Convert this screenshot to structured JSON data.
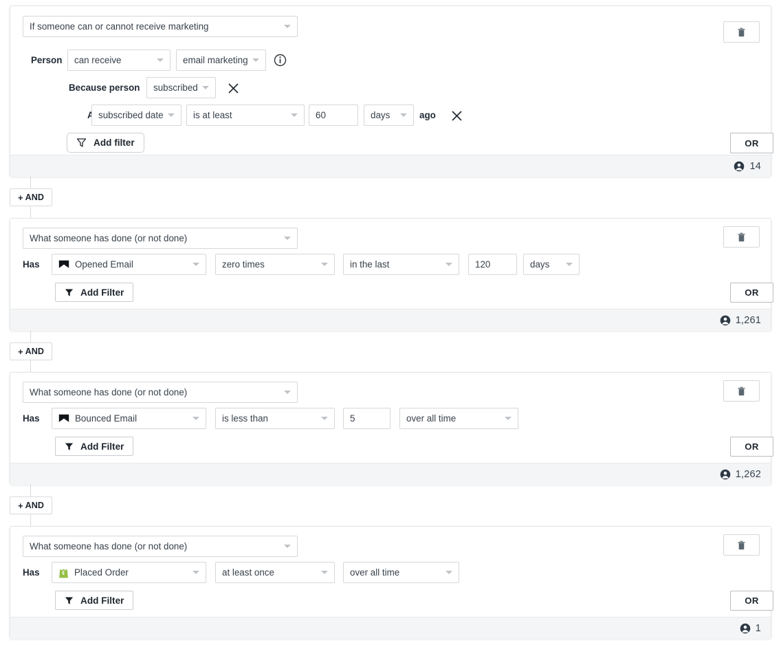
{
  "blocks": [
    {
      "id": "block-marketing",
      "type_select": "If someone can or cannot receive marketing",
      "rows": {
        "person_label": "Person",
        "can_receive": "can receive",
        "channel": "email marketing",
        "info_icon": "info-icon",
        "because_label": "Because person",
        "because_value": "subscribed",
        "and_label": "And",
        "date_field": "subscribed date",
        "operator": "is at least",
        "number": "60",
        "unit": "days",
        "ago_label": "ago"
      },
      "add_filter_label": "Add filter",
      "or_label": "OR",
      "delete_icon": "trash-icon",
      "count": "14"
    },
    {
      "id": "block-opened-email",
      "type_select": "What someone has done (or not done)",
      "rows": {
        "has_label": "Has",
        "metric": "Opened Email",
        "metric_icon": "klaviyo-email-icon",
        "frequency": "zero times",
        "timeframe": "in the last",
        "number": "120",
        "unit": "days"
      },
      "add_filter_label": "Add Filter",
      "or_label": "OR",
      "delete_icon": "trash-icon",
      "count": "1,261"
    },
    {
      "id": "block-bounced-email",
      "type_select": "What someone has done (or not done)",
      "rows": {
        "has_label": "Has",
        "metric": "Bounced Email",
        "metric_icon": "klaviyo-email-icon",
        "frequency": "is less than",
        "number": "5",
        "timeframe": "over all time"
      },
      "add_filter_label": "Add Filter",
      "or_label": "OR",
      "delete_icon": "trash-icon",
      "count": "1,262"
    },
    {
      "id": "block-placed-order",
      "type_select": "What someone has done (or not done)",
      "rows": {
        "has_label": "Has",
        "metric": "Placed Order",
        "metric_icon": "shopify-bag-icon",
        "frequency": "at least once",
        "timeframe": "over all time"
      },
      "add_filter_label": "Add Filter",
      "or_label": "OR",
      "delete_icon": "trash-icon",
      "count": "1"
    }
  ],
  "and_connectors": [
    {
      "label": "AND",
      "plus": "+"
    },
    {
      "label": "AND",
      "plus": "+"
    },
    {
      "label": "AND",
      "plus": "+"
    }
  ],
  "colors": {
    "card_border": "#e4e6e8",
    "footer_bg": "#f4f5f6",
    "control_border": "#d5d7da",
    "caret": "#bfc3c7",
    "text": "#38414a",
    "shopify_green": "#95bf47",
    "email_icon": "#111418"
  }
}
